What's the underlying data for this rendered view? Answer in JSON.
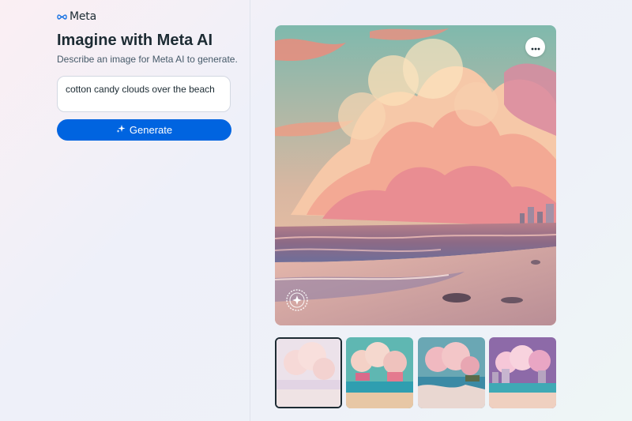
{
  "brand": {
    "name": "Meta",
    "logo_icon": "meta-infinity-icon"
  },
  "header": {
    "title": "Imagine with Meta AI",
    "subtitle": "Describe an image for Meta AI to generate."
  },
  "prompt": {
    "value": "cotton candy clouds over the beach"
  },
  "generate_button": {
    "label": "Generate",
    "icon": "sparkle-icon"
  },
  "result": {
    "more_icon": "more-horizontal-icon",
    "watermark_icon": "imagined-with-ai-badge-icon",
    "selected_index": 0,
    "thumbnails": [
      {
        "icon": "image-thumbnail",
        "selected": true
      },
      {
        "icon": "image-thumbnail",
        "selected": false
      },
      {
        "icon": "image-thumbnail",
        "selected": false
      },
      {
        "icon": "image-thumbnail",
        "selected": false
      }
    ]
  },
  "colors": {
    "accent": "#0064e0",
    "title": "#1c2b33",
    "subtitle": "#465a69"
  }
}
